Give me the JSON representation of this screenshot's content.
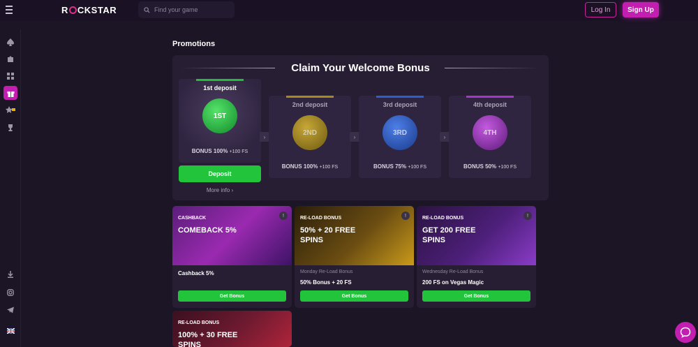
{
  "header": {
    "logo": "ROCKSTAR",
    "search_placeholder": "Find your game",
    "login": "Log In",
    "signup": "Sign Up"
  },
  "sidebar": {
    "items": [
      "spade-icon",
      "puzzle-icon",
      "grid-icon",
      "gift-icon",
      "star-lock-icon",
      "trophy-icon",
      "download-icon",
      "instagram-icon",
      "telegram-icon",
      "uk-flag-icon"
    ]
  },
  "page": {
    "title": "Promotions"
  },
  "welcome": {
    "title": "Claim Your Welcome Bonus",
    "deposits": [
      {
        "label": "1st deposit",
        "badge": "1ST",
        "bonus": "BONUS 100%",
        "fs": "+100 FS",
        "color": "#1fbf3c"
      },
      {
        "label": "2nd deposit",
        "badge": "2ND",
        "bonus": "BONUS 100%",
        "fs": "+100 FS",
        "color": "#a68a1a"
      },
      {
        "label": "3rd deposit",
        "badge": "3RD",
        "bonus": "BONUS 75%",
        "fs": "+100 FS",
        "color": "#2b5fd1"
      },
      {
        "label": "4th deposit",
        "badge": "4TH",
        "bonus": "BONUS 50%",
        "fs": "+100 FS",
        "color": "#a834c8"
      }
    ],
    "deposit_button": "Deposit",
    "more_info": "More info ›"
  },
  "offers": [
    {
      "tag": "CASHBACK",
      "headline": "COMEBACK 5%",
      "sub": "",
      "name": "Cashback 5%",
      "button": "Get Bonus"
    },
    {
      "tag": "RE-LOAD BONUS",
      "headline": "50% + 20 FREE SPINS",
      "sub": "Monday Re-Load Bonus",
      "name": "50% Bonus + 20 FS",
      "button": "Get Bonus"
    },
    {
      "tag": "RE-LOAD BONUS",
      "headline": "GET 200 FREE SPINS",
      "sub": "Wednesday Re-Load Bonus",
      "name": "200 FS on Vegas Magic",
      "button": "Get Bonus"
    },
    {
      "tag": "RE-LOAD BONUS",
      "headline": "100% + 30 FREE SPINS",
      "sub": "",
      "name": "",
      "button": ""
    }
  ],
  "colors": {
    "accent": "#c21fb0",
    "green": "#21c43a",
    "bg": "#1c1526",
    "card": "#271e33"
  }
}
